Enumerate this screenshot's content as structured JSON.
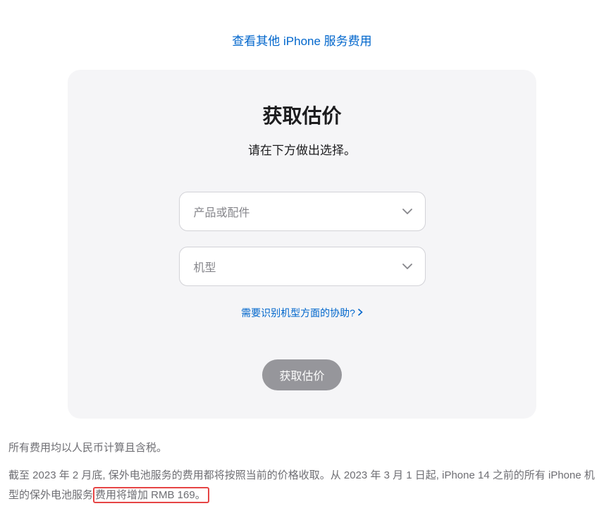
{
  "topLink": "查看其他 iPhone 服务费用",
  "card": {
    "title": "获取估价",
    "subtitle": "请在下方做出选择。",
    "select1_placeholder": "产品或配件",
    "select2_placeholder": "机型",
    "helpLink": "需要识别机型方面的协助?",
    "submitLabel": "获取估价"
  },
  "footer": {
    "line1": "所有费用均以人民币计算且含税。",
    "line2_a": "截至 2023 年 2 月底, 保外电池服务的费用都将按照当前的价格收取。从 2023 年 3 月 1 日起, iPhone 14 之前的所有 iPhone 机型的保外电池服务",
    "line2_b": "费用将增加 RMB 169。"
  }
}
